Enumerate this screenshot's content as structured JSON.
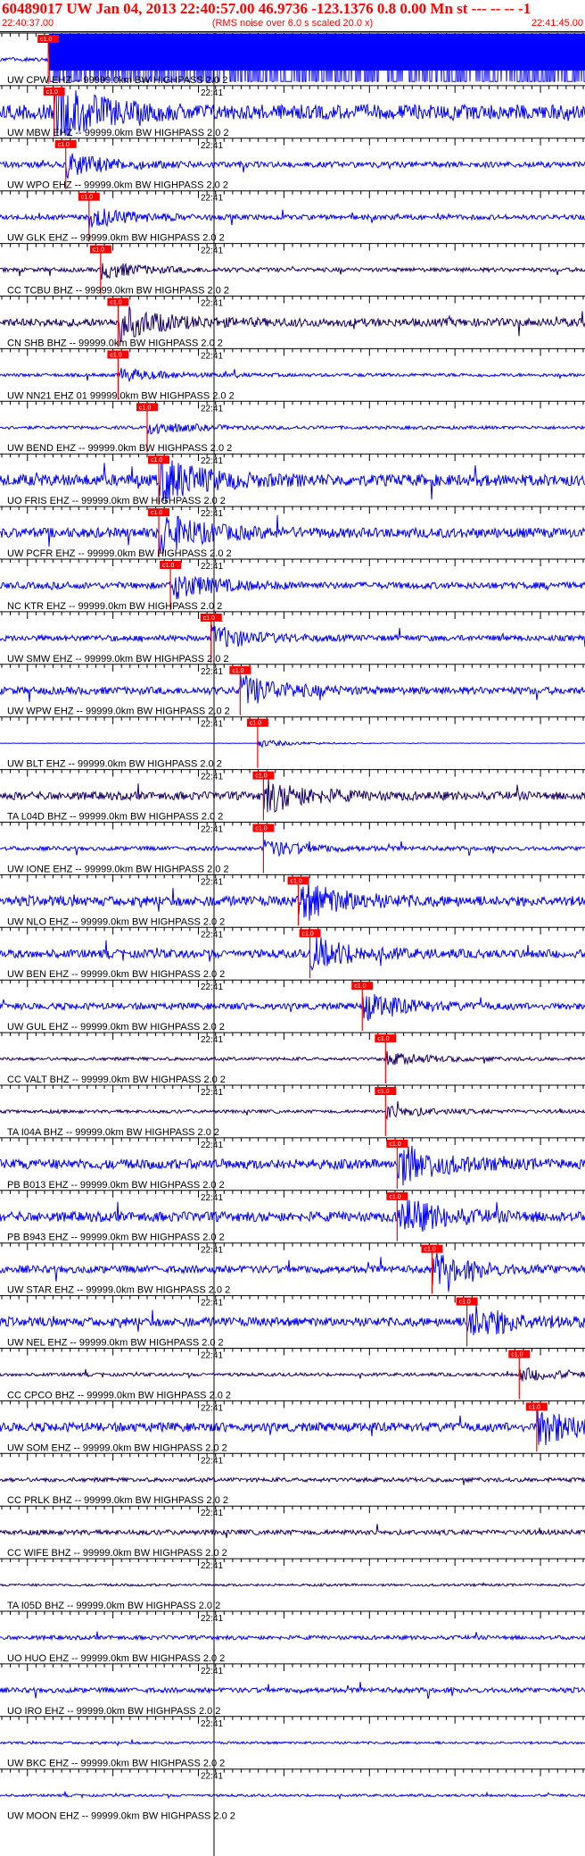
{
  "header": {
    "title": "60489017 UW Jan 04, 2013 22:40:57.00   46.9736 -123.1376  0.8 0.00 Mn st --- -- --  -1",
    "start_time": "22:40:37.00",
    "end_time": "22:41:45.00",
    "rms_note": "(RMS noise over 6.0 s scaled 20.0 x)"
  },
  "minute_label": "22:41",
  "colors": {
    "header": "#ff0000",
    "trace_blue": "#0000ff",
    "trace_dark": "#1a0066",
    "pick": "#ff0000",
    "axis": "#000000"
  },
  "traces": [
    {
      "label": "UW CPW EHZ -- 99999.0km BW  HIGHPASS  2.0  2",
      "color": "blue",
      "pick": 0.08,
      "amp": 1.0,
      "clip": true
    },
    {
      "label": "UW MBW EHZ -- 99999.0km BW  HIGHPASS  2.0  2",
      "color": "blue",
      "pick": 0.09,
      "amp": 0.9,
      "spiky": true
    },
    {
      "label": "UW WPO EHZ -- 99999.0km BW  HIGHPASS  2.0  2",
      "color": "blue",
      "pick": 0.11,
      "amp": 0.35
    },
    {
      "label": "UW GLK EHZ -- 99999.0km BW  HIGHPASS  2.0  2",
      "color": "blue",
      "pick": 0.15,
      "amp": 0.3
    },
    {
      "label": "CC TCBU BHZ -- 99999.0km BW  HIGHPASS  2.0  2",
      "color": "dark",
      "pick": 0.17,
      "amp": 0.25
    },
    {
      "label": "CN SHB BHZ -- 99999.0km BW  HIGHPASS  2.0  2",
      "color": "dark",
      "pick": 0.2,
      "amp": 0.5
    },
    {
      "label": "UW NN21 EHZ 01 99999.0km BW  HIGHPASS  2.0  2",
      "color": "blue",
      "pick": 0.2,
      "amp": 0.2
    },
    {
      "label": "UW BEND EHZ -- 99999.0km BW  HIGHPASS  2.0  2",
      "color": "blue",
      "pick": 0.25,
      "amp": 0.2
    },
    {
      "label": "UO FRIS EHZ -- 99999.0km BW  HIGHPASS  2.0  2",
      "color": "blue",
      "pick": 0.27,
      "amp": 0.7
    },
    {
      "label": "UW PCFR EHZ -- 99999.0km BW  HIGHPASS  2.0  2",
      "color": "blue",
      "pick": 0.27,
      "amp": 0.6
    },
    {
      "label": "NC KTR EHZ -- 99999.0km BW  HIGHPASS  2.0  2",
      "color": "blue",
      "pick": 0.29,
      "amp": 0.4
    },
    {
      "label": "UW SMW EHZ -- 99999.0km BW  HIGHPASS  2.0  2",
      "color": "blue",
      "pick": 0.36,
      "amp": 0.35
    },
    {
      "label": "UW WPW EHZ -- 99999.0km BW  HIGHPASS  2.0  2",
      "color": "blue",
      "pick": 0.41,
      "amp": 0.45
    },
    {
      "label": "UW BLT EHZ -- 99999.0km BW  HIGHPASS  2.0  2",
      "color": "blue",
      "pick": 0.44,
      "amp": 0.12,
      "quiet": true
    },
    {
      "label": "TA L04D BHZ -- 99999.0km BW  HIGHPASS  2.0  2",
      "color": "dark",
      "pick": 0.45,
      "amp": 0.5
    },
    {
      "label": "UW IONE EHZ -- 99999.0km BW  HIGHPASS  2.0  2",
      "color": "blue",
      "pick": 0.45,
      "amp": 0.25
    },
    {
      "label": "UW NLO EHZ -- 99999.0km BW  HIGHPASS  2.0  2",
      "color": "blue",
      "pick": 0.51,
      "amp": 0.6
    },
    {
      "label": "UW BEN EHZ -- 99999.0km BW  HIGHPASS  2.0  2",
      "color": "blue",
      "pick": 0.53,
      "amp": 0.5
    },
    {
      "label": "UW GUL EHZ -- 99999.0km BW  HIGHPASS  2.0  2",
      "color": "blue",
      "pick": 0.62,
      "amp": 0.4
    },
    {
      "label": "CC VALT BHZ -- 99999.0km BW  HIGHPASS  2.0  2",
      "color": "dark",
      "pick": 0.66,
      "amp": 0.2
    },
    {
      "label": "TA I04A BHZ -- 99999.0km BW  HIGHPASS  2.0  2",
      "color": "dark",
      "pick": 0.66,
      "amp": 0.2
    },
    {
      "label": "PB B013 EHZ -- 99999.0km BW  HIGHPASS  2.0  2",
      "color": "blue",
      "pick": 0.68,
      "amp": 0.6
    },
    {
      "label": "PB B943 EHZ -- 99999.0km BW  HIGHPASS  2.0  2",
      "color": "blue",
      "pick": 0.68,
      "amp": 0.6
    },
    {
      "label": "UW STAR EHZ -- 99999.0km BW  HIGHPASS  2.0  2",
      "color": "blue",
      "pick": 0.74,
      "amp": 0.45
    },
    {
      "label": "UW NEL EHZ -- 99999.0km BW  HIGHPASS  2.0  2",
      "color": "blue",
      "pick": 0.8,
      "amp": 0.55
    },
    {
      "label": "CC CPCO BHZ -- 99999.0km BW  HIGHPASS  2.0  2",
      "color": "dark",
      "pick": 0.89,
      "amp": 0.2
    },
    {
      "label": "UW SOM EHZ -- 99999.0km BW  HIGHPASS  2.0  2",
      "color": "blue",
      "pick": 0.92,
      "amp": 0.55
    },
    {
      "label": "CC PRLK BHZ -- 99999.0km BW  HIGHPASS  2.0  2",
      "color": "dark",
      "pick": null,
      "amp": 0.25
    },
    {
      "label": "CC WIFE BHZ -- 99999.0km BW  HIGHPASS  2.0  2",
      "color": "dark",
      "pick": null,
      "amp": 0.3
    },
    {
      "label": "TA I05D BHZ -- 99999.0km BW  HIGHPASS  2.0  2",
      "color": "dark",
      "pick": null,
      "amp": 0.15
    },
    {
      "label": "UO HUO EHZ -- 99999.0km BW  HIGHPASS  2.0  2",
      "color": "blue",
      "pick": null,
      "amp": 0.25
    },
    {
      "label": "UO IRO EHZ -- 99999.0km BW  HIGHPASS  2.0  2",
      "color": "blue",
      "pick": null,
      "amp": 0.3
    },
    {
      "label": "UW BKC EHZ -- 99999.0km BW  HIGHPASS  2.0  2",
      "color": "blue",
      "pick": null,
      "amp": 0.15
    },
    {
      "label": "UW MOON EHZ -- 99999.0km BW  HIGHPASS  2.0  2",
      "color": "blue",
      "pick": null,
      "amp": 0.15
    }
  ]
}
